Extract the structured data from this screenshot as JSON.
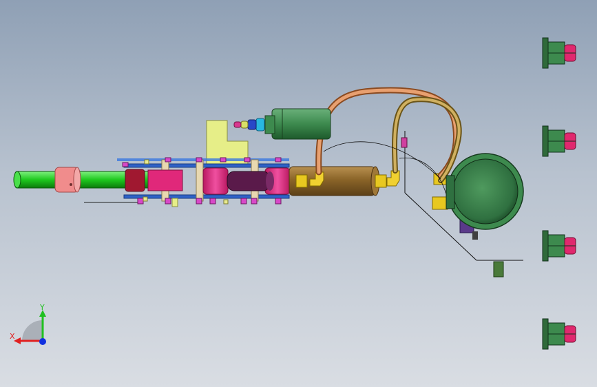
{
  "viewport": {
    "background_top": "#8fa0b5",
    "background_bottom": "#d9dde3"
  },
  "triad": {
    "x_label": "X",
    "y_label": "Y",
    "x_color": "#e02020",
    "y_color": "#20c020",
    "z_color": "#1030e0"
  },
  "colors": {
    "shaft": "#1ec81e",
    "collar": "#f08c8c",
    "pink_roller": "#e0287a",
    "dark_roller": "#5a1a4a",
    "brass_cylinder": "#8a6428",
    "copper_pipe": "#d08850",
    "tan_pipe": "#b89a48",
    "motor_green": "#3d8a4e",
    "blue_rail": "#2f62c8",
    "yellow_block": "#e6ee88",
    "fitting_yellow": "#e8c820",
    "castor_pink": "#e0286e"
  },
  "icons": {
    "triad": "coordinate-triad-icon",
    "castor": "castor-wheel-icon",
    "motor": "motor-icon"
  }
}
